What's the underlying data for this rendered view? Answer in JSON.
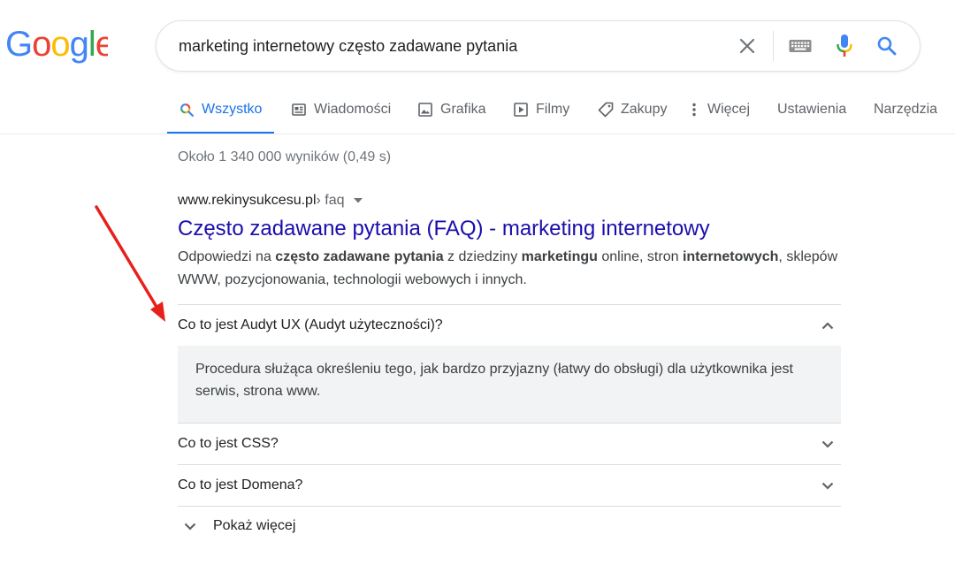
{
  "logo": {
    "text": "Google",
    "colors": [
      "#4285F4",
      "#EA4335",
      "#FBBC05",
      "#4285F4",
      "#34A853",
      "#EA4335"
    ]
  },
  "search": {
    "query": "marketing internetowy często zadawane pytania"
  },
  "tabs": [
    {
      "label": "Wszystko",
      "icon": "search-icon",
      "active": true
    },
    {
      "label": "Wiadomości",
      "icon": "news-icon"
    },
    {
      "label": "Grafika",
      "icon": "image-icon"
    },
    {
      "label": "Filmy",
      "icon": "play-icon"
    },
    {
      "label": "Zakupy",
      "icon": "tag-icon"
    },
    {
      "label": "Więcej",
      "icon": "more-vert-icon"
    },
    {
      "label": "Ustawienia"
    },
    {
      "label": "Narzędzia"
    }
  ],
  "stats": "Około 1 340 000 wyników (0,49 s)",
  "result": {
    "domain": "www.rekinysukcesu.pl",
    "path": " › faq",
    "title": "Często zadawane pytania (FAQ) - marketing internetowy",
    "snippet": {
      "p1": "Odpowiedzi na ",
      "b1": "często zadawane pytania",
      "p2": " z dziedziny ",
      "b2": "marketingu",
      "p3": " online, stron ",
      "b3": "internetowych",
      "p4": ", sklepów WWW, pozycjonowania, technologii webowych i innych."
    }
  },
  "faq": [
    {
      "question": "Co to jest Audyt UX (Audyt użyteczności)?",
      "expanded": true,
      "answer": "Procedura służąca określeniu tego, jak bardzo przyjazny (łatwy do obsługi) dla użytkownika jest serwis, strona www."
    },
    {
      "question": "Co to jest CSS?",
      "expanded": false
    },
    {
      "question": "Co to jest Domena?",
      "expanded": false
    }
  ],
  "show_more": "Pokaż więcej",
  "colors": {
    "accent": "#1a73e8",
    "link": "#1a0dab",
    "annotation_arrow": "#e8201b"
  }
}
